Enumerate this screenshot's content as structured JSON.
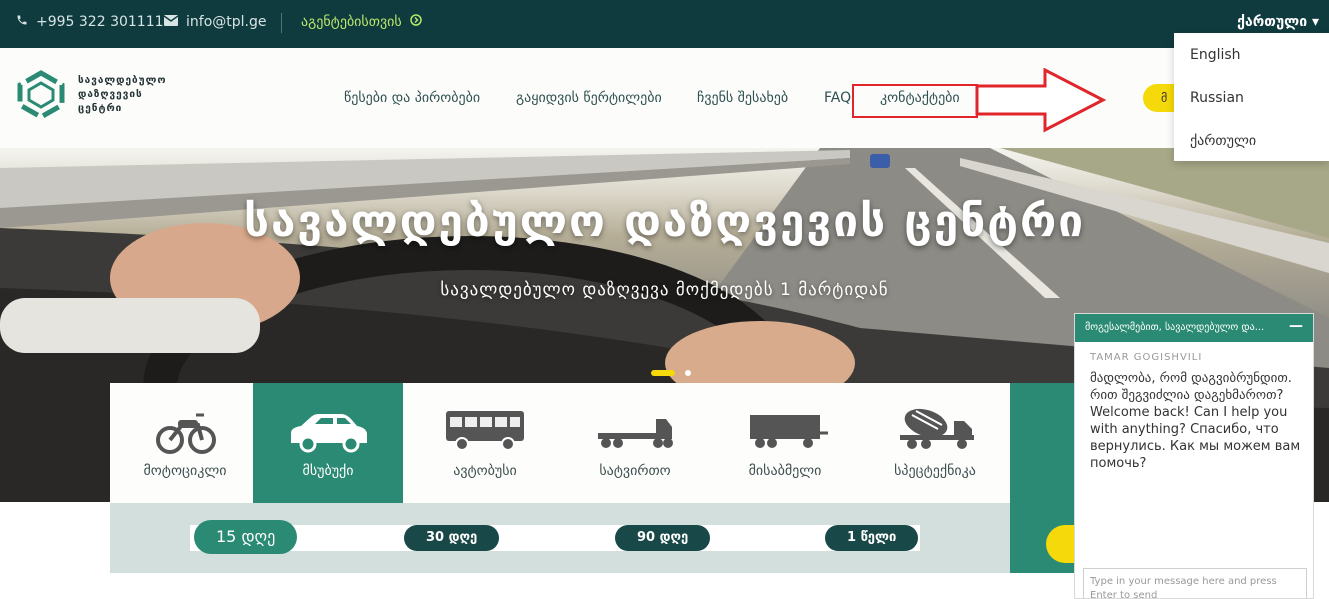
{
  "topbar": {
    "phone": "+995 322 301111",
    "email": "info@tpl.ge",
    "agents_link": "აგენტებისთვის",
    "current_language": "ქართული"
  },
  "header": {
    "logo_lines": [
      "სავალდებულო",
      "დაზღვევის",
      "ცენტრი"
    ],
    "nav": [
      {
        "label": "წესები და პირობები"
      },
      {
        "label": "გაყიდვის წერტილები"
      },
      {
        "label": "ჩვენს შესახებ"
      },
      {
        "label": "FAQ"
      },
      {
        "label": "კონტაქტები"
      }
    ],
    "yellow_button_fragment": "მ"
  },
  "hero": {
    "title": "სავალდებულო დაზღვევის ცენტრი",
    "subtitle": "სავალდებულო დაზღვევა მოქმედებს 1 მარტიდან"
  },
  "vehicles": [
    {
      "label": "მოტოციკლი",
      "icon": "motorcycle-icon",
      "active": false
    },
    {
      "label": "მსუბუქი",
      "icon": "car-icon",
      "active": true
    },
    {
      "label": "ავტობუსი",
      "icon": "bus-icon",
      "active": false
    },
    {
      "label": "სატვირთო",
      "icon": "truck-icon",
      "active": false
    },
    {
      "label": "მისაბმელი",
      "icon": "trailer-icon",
      "active": false
    },
    {
      "label": "სპეცტექნიკა",
      "icon": "cement-mixer-icon",
      "active": false
    }
  ],
  "durations": [
    {
      "label": "15 დღე",
      "active": true
    },
    {
      "label": "30 დღე",
      "active": false
    },
    {
      "label": "90 დღე",
      "active": false
    },
    {
      "label": "1 წელი",
      "active": false
    }
  ],
  "language_menu": {
    "items": [
      "English",
      "Russian",
      "ქართული"
    ]
  },
  "chat": {
    "header": "მოგესალმებით, სავალდებულო და...",
    "minimize": "—",
    "agent_name": "TAMAR GOGISHVILI",
    "message": "მადლობა, რომ დაგვიბრუნდით. რით შეგვიძლია დაგეხმაროთ? Welcome back! Can I help you with anything? Спасибо, что вернулись. Как мы можем вам помочь?",
    "input_placeholder": "Type in your message here and press Enter to send"
  },
  "colors": {
    "topbar_bg": "#0f3b3f",
    "brand_green": "#2a8a73",
    "dark_pill": "#184847",
    "accent_yellow": "#f5d90a",
    "highlight_red": "#e0262a",
    "agents_link": "#b9e76a"
  }
}
